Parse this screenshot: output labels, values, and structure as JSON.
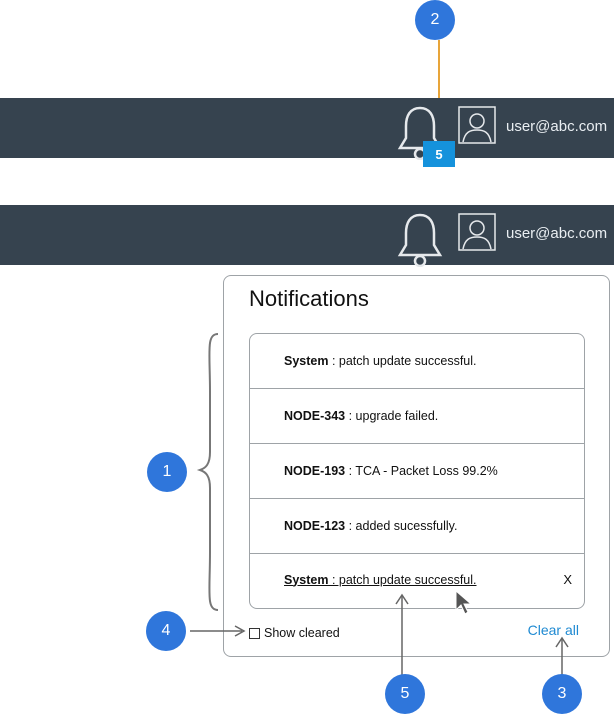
{
  "header": {
    "user_email": "user@abc.com",
    "notification_count": "5"
  },
  "notifications_panel": {
    "title": "Notifications",
    "items": [
      {
        "source": "System",
        "message": " : patch update successful."
      },
      {
        "source": "NODE-343",
        "message": " : upgrade failed."
      },
      {
        "source": "NODE-193",
        "message": " : TCA - Packet Loss 99.2%"
      },
      {
        "source": "NODE-123",
        "message": " : added sucessfully."
      },
      {
        "source": "System",
        "message": " : patch update successful.",
        "close_label": "X"
      }
    ],
    "show_cleared_label": "Show cleared",
    "clear_all_label": "Clear all"
  },
  "callouts": [
    "1",
    "2",
    "3",
    "4",
    "5"
  ],
  "colors": {
    "header_bg": "#36434f",
    "badge": "#1592dc",
    "callout": "#2f76db",
    "link": "#1f8ad2",
    "arrow": "#666666",
    "arrow_highlight": "#e8a53a"
  }
}
